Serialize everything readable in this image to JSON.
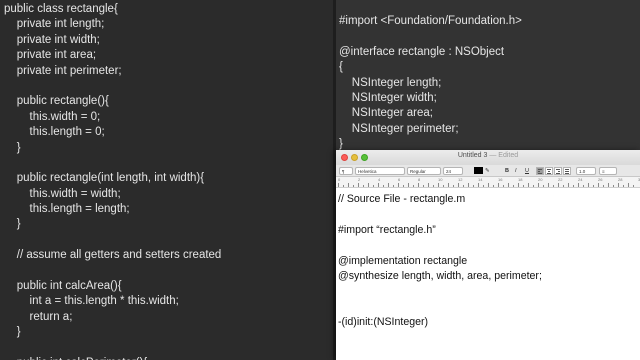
{
  "left_pane": {
    "lines": [
      "public class rectangle{",
      "    private int length;",
      "    private int width;",
      "    private int area;",
      "    private int perimeter;",
      "",
      "    public rectangle(){",
      "        this.width = 0;",
      "        this.length = 0;",
      "    }",
      "",
      "    public rectangle(int length, int width){",
      "        this.width = width;",
      "        this.length = length;",
      "    }",
      "",
      "    // assume all getters and setters created",
      "",
      "    public int calcArea(){",
      "        int a = this.length * this.width;",
      "        return a;",
      "    }",
      "",
      "    public int calcPerimeter(){"
    ]
  },
  "right_pane": {
    "lines": [
      "#import <Foundation/Foundation.h>",
      "",
      "@interface rectangle : NSObject",
      "{",
      "    NSInteger length;",
      "    NSInteger width;",
      "    NSInteger area;",
      "    NSInteger perimeter;",
      "}"
    ]
  },
  "textedit": {
    "title": "Untitled 3",
    "edited": " — Edited",
    "toolbar": {
      "paragraph_style": "¶",
      "font_family": "Helvetica",
      "font_style": "Regular",
      "font_size": "24",
      "text_color": "#000000",
      "bold": "B",
      "italic": "I",
      "underline": "U",
      "line_spacing": "1.0",
      "list": "≡"
    },
    "ruler": {
      "numbers": [
        "0",
        "2",
        "4",
        "6",
        "8",
        "10",
        "12",
        "14",
        "16",
        "18",
        "20",
        "22",
        "24",
        "26",
        "28",
        "30"
      ]
    },
    "document_lines": [
      "// Source File - rectangle.m",
      "",
      "#import “rectangle.h”",
      "",
      "@implementation rectangle",
      "@synthesize length, width, area, perimeter;",
      "",
      "",
      "-(id)init:(NSInteger)"
    ]
  }
}
